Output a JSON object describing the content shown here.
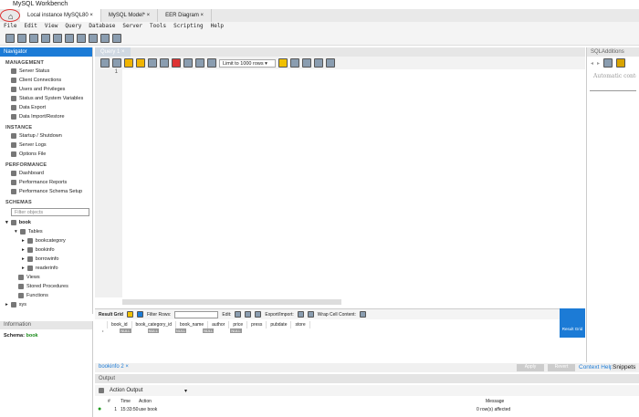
{
  "window": {
    "title": "MySQL Workbench"
  },
  "tabs": [
    {
      "label": "Local instance MySQL80"
    },
    {
      "label": "MySQL Model*"
    },
    {
      "label": "EER Diagram"
    }
  ],
  "menu": [
    "File",
    "Edit",
    "View",
    "Query",
    "Database",
    "Server",
    "Tools",
    "Scripting",
    "Help"
  ],
  "navigator": {
    "title": "Navigator",
    "management": {
      "title": "MANAGEMENT",
      "items": [
        "Server Status",
        "Client Connections",
        "Users and Privileges",
        "Status and System Variables",
        "Data Export",
        "Data Import/Restore"
      ]
    },
    "instance": {
      "title": "INSTANCE",
      "items": [
        "Startup / Shutdown",
        "Server Logs",
        "Options File"
      ]
    },
    "performance": {
      "title": "PERFORMANCE",
      "items": [
        "Dashboard",
        "Performance Reports",
        "Performance Schema Setup"
      ]
    },
    "schemas": {
      "title": "SCHEMAS",
      "filter_placeholder": "Filter objects",
      "db": "book",
      "tables_label": "Tables",
      "tables": [
        "bookcategory",
        "bookinfo",
        "borrowinfo",
        "readerinfo"
      ],
      "others": [
        "Views",
        "Stored Procedures",
        "Functions"
      ],
      "db2": "sys"
    }
  },
  "information": {
    "title": "Information",
    "schema_label": "Schema:",
    "schema_value": "book"
  },
  "editor": {
    "tab": "Query 1",
    "line": "1",
    "limit": "Limit to 1000 rows"
  },
  "sql_additions": {
    "title": "SQLAdditions",
    "text": "Automatic context help is disabled. Use the toolbar to manually get help for the current caret position or"
  },
  "result": {
    "result_grid": "Result Grid",
    "filter_rows": "Filter Rows:",
    "edit": "Edit:",
    "export": "Export/Import:",
    "wrap": "Wrap Cell Content:",
    "columns": [
      "book_id",
      "book_category_id",
      "book_name",
      "author",
      "price",
      "press",
      "pubdate",
      "store"
    ],
    "null": "NULL",
    "side_button": "Result Grid"
  },
  "bottom_tabs": {
    "tab": "bookinfo 2",
    "apply": "Apply",
    "revert": "Revert",
    "context_help": "Context Help",
    "snippets": "Snippets"
  },
  "output": {
    "title": "Output",
    "selector": "Action Output",
    "headers": [
      "#",
      "Time",
      "Action",
      "Message"
    ],
    "rows": [
      {
        "n": "1",
        "time": "15:33:50",
        "action": "use book",
        "message": "0 row(s) affected",
        "status": "success"
      }
    ]
  },
  "colors": {
    "accent": "#1c7bd6"
  }
}
